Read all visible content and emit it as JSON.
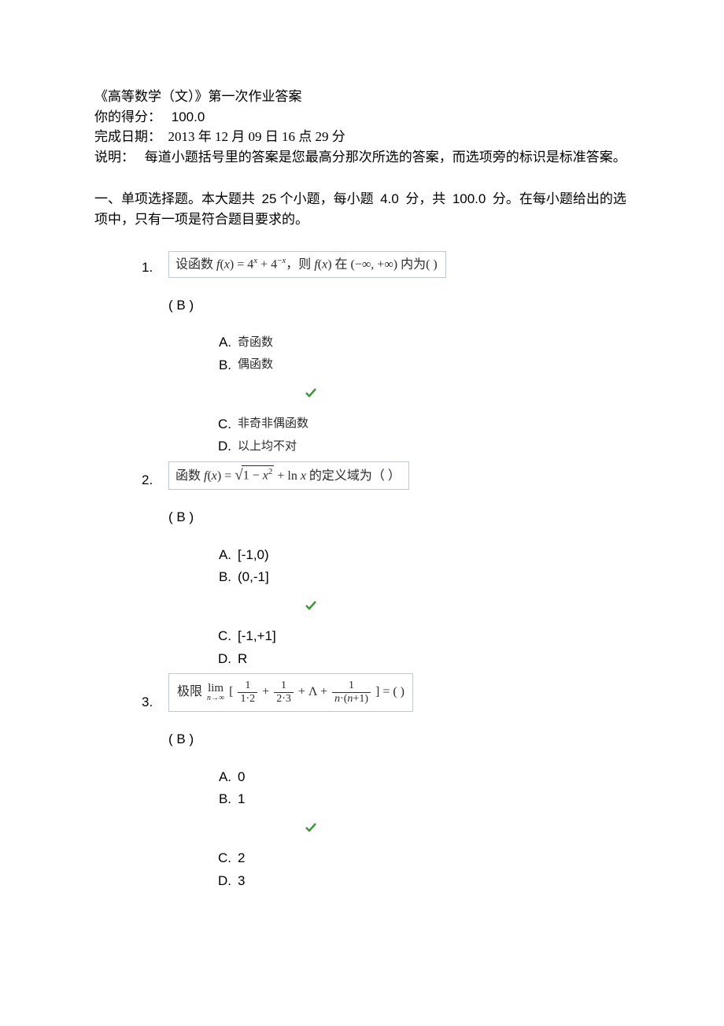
{
  "header": {
    "title": "《高等数学（文）》第一次作业答案",
    "score_label": "你的得分：",
    "score_value": "100.0",
    "completed_label": "完成日期：",
    "completed_value": "2013 年 12 月 09 日 16 点 29 分",
    "note_label": "说明：",
    "note_text": "每道小题括号里的答案是您最高分那次所选的答案，而选项旁的标识是标准答案。"
  },
  "section": {
    "heading_a": "一、单项选择题。本大题共",
    "q_count": "25",
    "heading_b": "个小题，每小题",
    "points_each": "4.0",
    "heading_c": "分，共",
    "points_total": "100.0",
    "heading_d": "分。在每小题给出的选项中，只有一项是符合题目要求的。"
  },
  "questions": [
    {
      "num": "1.",
      "stem_prefix_cn": "设函数 ",
      "stem_suffix_cn": " 内为(     )",
      "selected": "( B )",
      "options": [
        {
          "letter": "A.",
          "text": "奇函数"
        },
        {
          "letter": "B.",
          "text": "偶函数"
        },
        {
          "letter": "C.",
          "text": "非奇非偶函数"
        },
        {
          "letter": "D.",
          "text": "以上均不对"
        }
      ],
      "correct_index": 1
    },
    {
      "num": "2.",
      "stem_prefix_cn": "函数 ",
      "stem_suffix_cn": " 的定义域为（    ）",
      "selected": "( B )",
      "options": [
        {
          "letter": "A.",
          "text": "[-1,0)"
        },
        {
          "letter": "B.",
          "text": "(0,-1]"
        },
        {
          "letter": "C.",
          "text": "[-1,+1]"
        },
        {
          "letter": "D.",
          "text": "R"
        }
      ],
      "correct_index": 1
    },
    {
      "num": "3.",
      "stem_prefix_cn": "极限 ",
      "stem_suffix_cn": " = (     )",
      "selected": "( B )",
      "options": [
        {
          "letter": "A.",
          "text": "0"
        },
        {
          "letter": "B.",
          "text": "1"
        },
        {
          "letter": "C.",
          "text": "2"
        },
        {
          "letter": "D.",
          "text": "3"
        }
      ],
      "correct_index": 1
    }
  ]
}
